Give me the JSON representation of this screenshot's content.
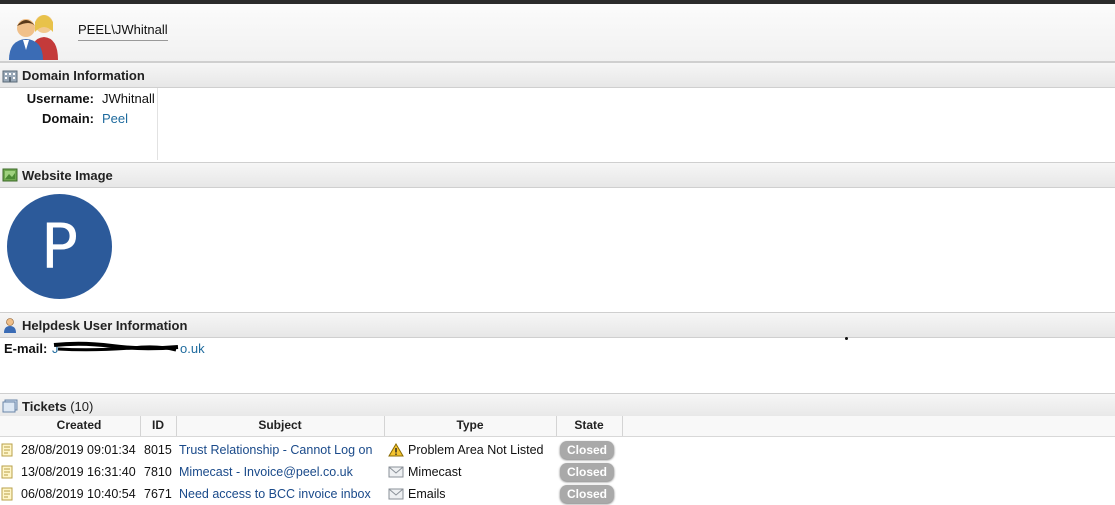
{
  "header": {
    "title": "PEEL\\JWhitnall",
    "avatar_icon": "users-icon"
  },
  "domain_info": {
    "heading": "Domain Information",
    "icon": "building-icon",
    "username_label": "Username:",
    "username_value": "JWhitnall",
    "domain_label": "Domain:",
    "domain_value": "Peel"
  },
  "website_image": {
    "heading": "Website Image",
    "icon": "image-icon",
    "avatar_letter": "P",
    "avatar_color": "#2c5a9a"
  },
  "helpdesk_info": {
    "heading": "Helpdesk User Information",
    "icon": "user-icon",
    "email_label": "E-mail:",
    "email_visible_start": "J",
    "email_visible_end": "o.uk"
  },
  "tickets": {
    "heading": "Tickets",
    "count": "(10)",
    "icon": "tickets-icon",
    "columns": [
      "Created",
      "ID",
      "Subject",
      "Type",
      "State"
    ],
    "rows": [
      {
        "created": "28/08/2019 09:01:34",
        "id": "8015",
        "subject": "Trust Relationship - Cannot Log on",
        "type": "Problem Area Not Listed",
        "type_icon": "warning-icon",
        "state": "Closed"
      },
      {
        "created": "13/08/2019 16:31:40",
        "id": "7810",
        "subject": "Mimecast - Invoice@peel.co.uk",
        "type": "Mimecast",
        "type_icon": "envelope-icon",
        "state": "Closed"
      },
      {
        "created": "06/08/2019 10:40:54",
        "id": "7671",
        "subject": "Need access to BCC invoice inbox",
        "type": "Emails",
        "type_icon": "envelope-icon",
        "state": "Closed"
      }
    ]
  }
}
